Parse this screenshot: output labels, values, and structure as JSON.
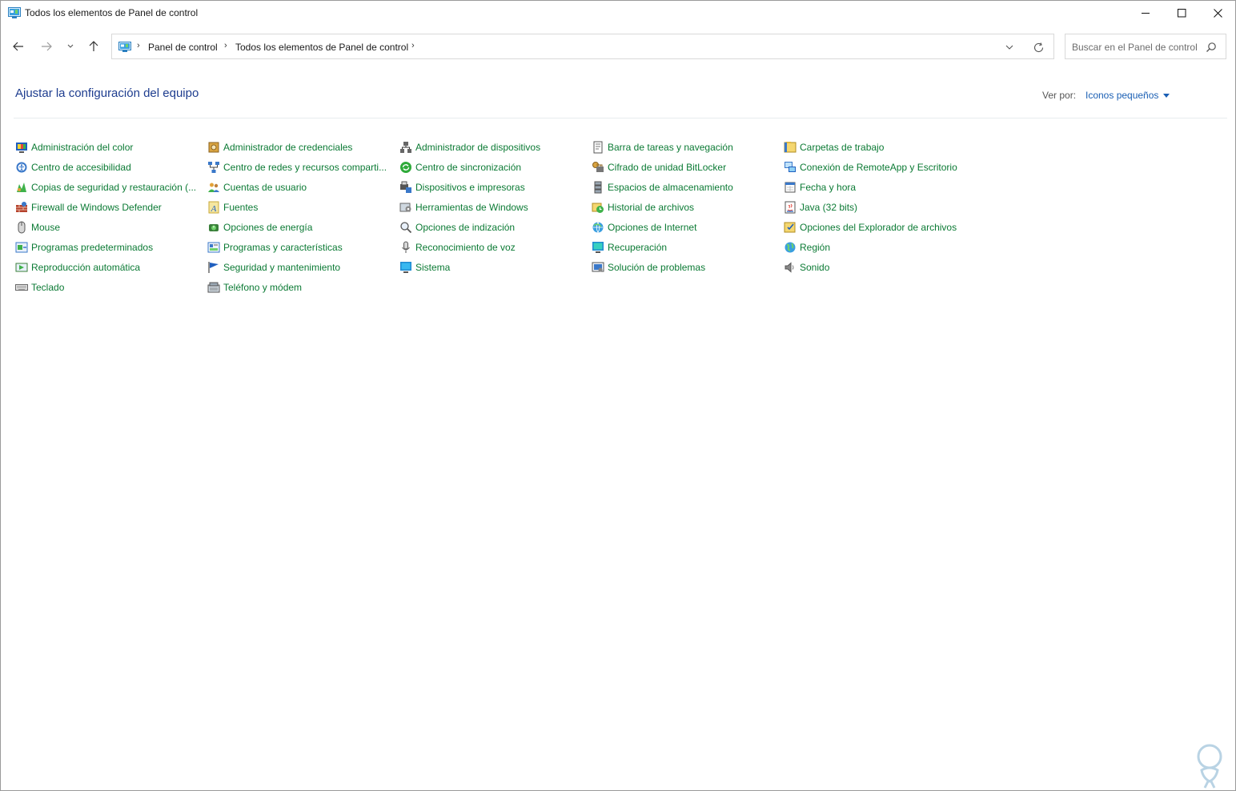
{
  "window": {
    "title": "Todos los elementos de Panel de control",
    "controls": [
      "minimize-icon",
      "maximize-icon",
      "close-icon"
    ]
  },
  "navigation": {
    "buttons": [
      "back-arrow-icon",
      "forward-arrow-icon",
      "recent-locations-chevron-icon",
      "up-arrow-icon"
    ],
    "breadcrumb": [
      "Panel de control",
      "Todos los elementos de Panel de control"
    ],
    "search_placeholder": "Buscar en el Panel de control"
  },
  "header": {
    "title": "Ajustar la configuración del equipo",
    "view_by_label": "Ver por:",
    "view_by_value": "Iconos pequeños"
  },
  "columns": [
    [
      {
        "label": "Administración del color",
        "icon": "color-management-icon"
      },
      {
        "label": "Centro de accesibilidad",
        "icon": "accessibility-icon"
      },
      {
        "label": "Copias de seguridad y restauración (...",
        "icon": "backup-restore-icon"
      },
      {
        "label": "Firewall de Windows Defender",
        "icon": "firewall-icon"
      },
      {
        "label": "Mouse",
        "icon": "mouse-icon"
      },
      {
        "label": "Programas predeterminados",
        "icon": "default-programs-icon"
      },
      {
        "label": "Reproducción automática",
        "icon": "autoplay-icon"
      },
      {
        "label": "Teclado",
        "icon": "keyboard-icon"
      }
    ],
    [
      {
        "label": "Administrador de credenciales",
        "icon": "credential-manager-icon"
      },
      {
        "label": "Centro de redes y recursos comparti...",
        "icon": "network-center-icon"
      },
      {
        "label": "Cuentas de usuario",
        "icon": "user-accounts-icon"
      },
      {
        "label": "Fuentes",
        "icon": "fonts-icon"
      },
      {
        "label": "Opciones de energía",
        "icon": "power-options-icon"
      },
      {
        "label": "Programas y características",
        "icon": "programs-features-icon"
      },
      {
        "label": "Seguridad y mantenimiento",
        "icon": "security-maintenance-icon"
      },
      {
        "label": "Teléfono y módem",
        "icon": "phone-modem-icon"
      }
    ],
    [
      {
        "label": "Administrador de dispositivos",
        "icon": "device-manager-icon"
      },
      {
        "label": "Centro de sincronización",
        "icon": "sync-center-icon"
      },
      {
        "label": "Dispositivos e impresoras",
        "icon": "devices-printers-icon"
      },
      {
        "label": "Herramientas de Windows",
        "icon": "windows-tools-icon"
      },
      {
        "label": "Opciones de indización",
        "icon": "indexing-options-icon"
      },
      {
        "label": "Reconocimiento de voz",
        "icon": "speech-recognition-icon"
      },
      {
        "label": "Sistema",
        "icon": "system-icon"
      }
    ],
    [
      {
        "label": "Barra de tareas y navegación",
        "icon": "taskbar-icon"
      },
      {
        "label": "Cifrado de unidad BitLocker",
        "icon": "bitlocker-icon"
      },
      {
        "label": "Espacios de almacenamiento",
        "icon": "storage-spaces-icon"
      },
      {
        "label": "Historial de archivos",
        "icon": "file-history-icon"
      },
      {
        "label": "Opciones de Internet",
        "icon": "internet-options-icon"
      },
      {
        "label": "Recuperación",
        "icon": "recovery-icon"
      },
      {
        "label": "Solución de problemas",
        "icon": "troubleshooting-icon"
      }
    ],
    [
      {
        "label": "Carpetas de trabajo",
        "icon": "work-folders-icon"
      },
      {
        "label": "Conexión de RemoteApp y Escritorio",
        "icon": "remoteapp-icon"
      },
      {
        "label": "Fecha y hora",
        "icon": "date-time-icon"
      },
      {
        "label": "Java (32 bits)",
        "icon": "java-icon"
      },
      {
        "label": "Opciones del Explorador de archivos",
        "icon": "explorer-options-icon"
      },
      {
        "label": "Región",
        "icon": "region-icon"
      },
      {
        "label": "Sonido",
        "icon": "sound-icon"
      }
    ]
  ],
  "watermark": {
    "icon": "watermark-logo-icon"
  }
}
